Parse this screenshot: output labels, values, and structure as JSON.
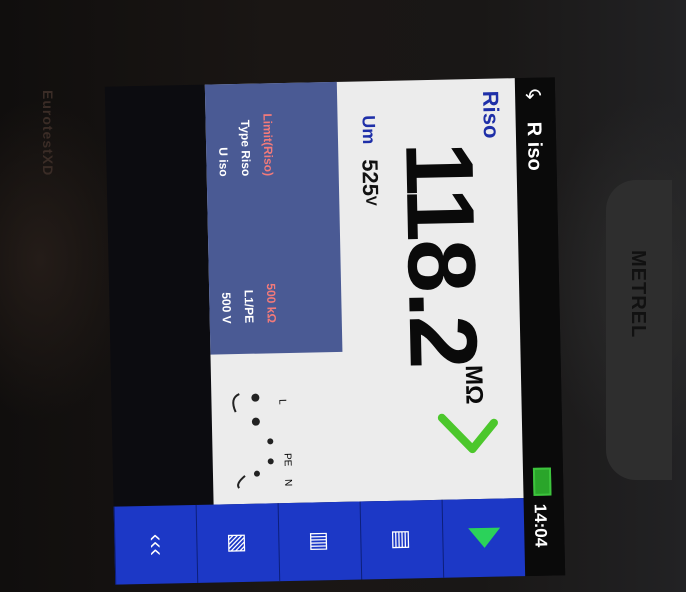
{
  "header": {
    "back_symbol": "↶",
    "title": "R iso",
    "time": "14:04"
  },
  "brand": {
    "device_side_text": "EurotestXD",
    "logo_text": "METREL"
  },
  "measurement": {
    "label": "Riso",
    "value": "118.2",
    "unit": "MΩ",
    "pass": true,
    "accent_colors": {
      "label": "#1e2fa8",
      "pass": "#4cc72c",
      "limit": "#f27a7a"
    }
  },
  "um": {
    "label": "Um",
    "value": "525",
    "unit": "V"
  },
  "parameters": [
    {
      "label": "U iso",
      "value": "500 V"
    },
    {
      "label": "Type Riso",
      "value": "L1/PE"
    },
    {
      "label": "Limit(Riso)",
      "value": "500 kΩ"
    }
  ],
  "terminals": {
    "l": "L",
    "pe": "PE",
    "n": "N"
  },
  "footer": {
    "buttons": [
      {
        "name": "start-arrow-icon"
      },
      {
        "name": "memory-card-icon"
      },
      {
        "name": "results-icon"
      },
      {
        "name": "notes-icon"
      },
      {
        "name": "back-chevrons-icon",
        "symbol": "‹‹‹"
      }
    ]
  }
}
